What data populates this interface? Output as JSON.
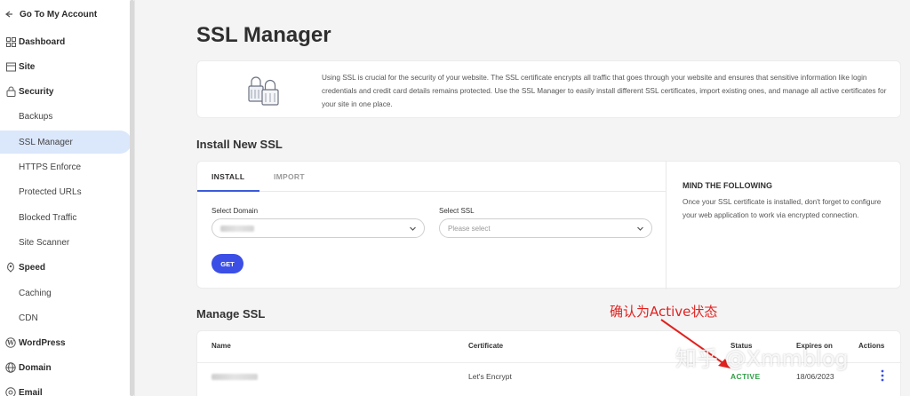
{
  "sidebar": {
    "back_label": "Go To My Account",
    "items": [
      {
        "label": "Dashboard",
        "icon": "grid-icon",
        "kind": "top"
      },
      {
        "label": "Site",
        "icon": "site-icon",
        "kind": "top"
      },
      {
        "label": "Security",
        "icon": "lock-icon",
        "kind": "section"
      },
      {
        "label": "Backups",
        "kind": "sub"
      },
      {
        "label": "SSL Manager",
        "kind": "sub",
        "active": true
      },
      {
        "label": "HTTPS Enforce",
        "kind": "sub"
      },
      {
        "label": "Protected URLs",
        "kind": "sub"
      },
      {
        "label": "Blocked Traffic",
        "kind": "sub"
      },
      {
        "label": "Site Scanner",
        "kind": "sub"
      },
      {
        "label": "Speed",
        "icon": "rocket-icon",
        "kind": "section"
      },
      {
        "label": "Caching",
        "kind": "sub"
      },
      {
        "label": "CDN",
        "kind": "sub"
      },
      {
        "label": "WordPress",
        "icon": "wordpress-icon",
        "kind": "top"
      },
      {
        "label": "Domain",
        "icon": "globe-icon",
        "kind": "top"
      },
      {
        "label": "Email",
        "icon": "mail-icon",
        "kind": "top"
      }
    ]
  },
  "page": {
    "title": "SSL Manager",
    "info_text": "Using SSL is crucial for the security of your website. The SSL certificate encrypts all traffic that goes through your website and ensures that sensitive information like login credentials and credit card details remains protected. Use the SSL Manager to easily install different SSL certificates, import existing ones, and manage all active certificates for your site in one place."
  },
  "install": {
    "heading": "Install New SSL",
    "tabs": [
      "INSTALL",
      "IMPORT"
    ],
    "active_tab": "INSTALL",
    "domain_label": "Select Domain",
    "ssl_label": "Select SSL",
    "ssl_placeholder": "Please select",
    "get_button": "GET",
    "mind_title": "MIND THE FOLLOWING",
    "mind_text": "Once your SSL certificate is installed, don't forget to configure your web application to work via encrypted connection."
  },
  "manage": {
    "heading": "Manage SSL",
    "columns": [
      "Name",
      "Certificate",
      "Status",
      "Expires on",
      "Actions"
    ],
    "rows": [
      {
        "certificate": "Let's Encrypt",
        "status": "ACTIVE",
        "expires": "18/06/2023"
      }
    ]
  },
  "annotation": {
    "text": "确认为Active状态",
    "color": "#e0221f"
  },
  "watermark": "知乎 @Xmmblog",
  "colors": {
    "accent": "#3b4fe6",
    "active_nav": "#dbe7fb",
    "status_active": "#2e9e45"
  }
}
